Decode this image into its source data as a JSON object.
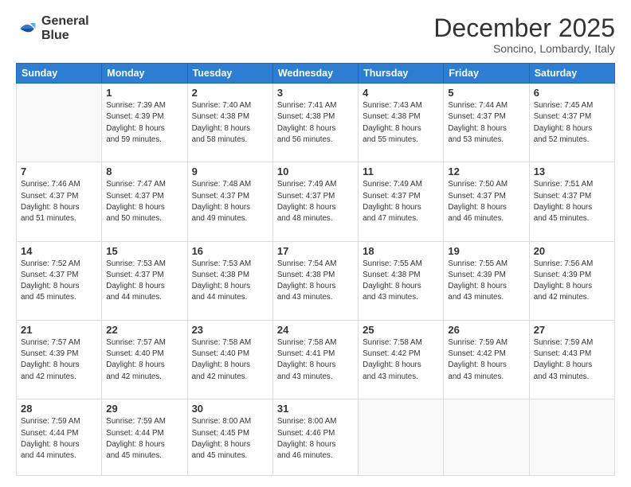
{
  "logo": {
    "line1": "General",
    "line2": "Blue"
  },
  "title": "December 2025",
  "location": "Soncino, Lombardy, Italy",
  "header_row": [
    "Sunday",
    "Monday",
    "Tuesday",
    "Wednesday",
    "Thursday",
    "Friday",
    "Saturday"
  ],
  "weeks": [
    [
      {
        "day": "",
        "info": ""
      },
      {
        "day": "1",
        "info": "Sunrise: 7:39 AM\nSunset: 4:39 PM\nDaylight: 8 hours\nand 59 minutes."
      },
      {
        "day": "2",
        "info": "Sunrise: 7:40 AM\nSunset: 4:38 PM\nDaylight: 8 hours\nand 58 minutes."
      },
      {
        "day": "3",
        "info": "Sunrise: 7:41 AM\nSunset: 4:38 PM\nDaylight: 8 hours\nand 56 minutes."
      },
      {
        "day": "4",
        "info": "Sunrise: 7:43 AM\nSunset: 4:38 PM\nDaylight: 8 hours\nand 55 minutes."
      },
      {
        "day": "5",
        "info": "Sunrise: 7:44 AM\nSunset: 4:37 PM\nDaylight: 8 hours\nand 53 minutes."
      },
      {
        "day": "6",
        "info": "Sunrise: 7:45 AM\nSunset: 4:37 PM\nDaylight: 8 hours\nand 52 minutes."
      }
    ],
    [
      {
        "day": "7",
        "info": "Sunrise: 7:46 AM\nSunset: 4:37 PM\nDaylight: 8 hours\nand 51 minutes."
      },
      {
        "day": "8",
        "info": "Sunrise: 7:47 AM\nSunset: 4:37 PM\nDaylight: 8 hours\nand 50 minutes."
      },
      {
        "day": "9",
        "info": "Sunrise: 7:48 AM\nSunset: 4:37 PM\nDaylight: 8 hours\nand 49 minutes."
      },
      {
        "day": "10",
        "info": "Sunrise: 7:49 AM\nSunset: 4:37 PM\nDaylight: 8 hours\nand 48 minutes."
      },
      {
        "day": "11",
        "info": "Sunrise: 7:49 AM\nSunset: 4:37 PM\nDaylight: 8 hours\nand 47 minutes."
      },
      {
        "day": "12",
        "info": "Sunrise: 7:50 AM\nSunset: 4:37 PM\nDaylight: 8 hours\nand 46 minutes."
      },
      {
        "day": "13",
        "info": "Sunrise: 7:51 AM\nSunset: 4:37 PM\nDaylight: 8 hours\nand 45 minutes."
      }
    ],
    [
      {
        "day": "14",
        "info": "Sunrise: 7:52 AM\nSunset: 4:37 PM\nDaylight: 8 hours\nand 45 minutes."
      },
      {
        "day": "15",
        "info": "Sunrise: 7:53 AM\nSunset: 4:37 PM\nDaylight: 8 hours\nand 44 minutes."
      },
      {
        "day": "16",
        "info": "Sunrise: 7:53 AM\nSunset: 4:38 PM\nDaylight: 8 hours\nand 44 minutes."
      },
      {
        "day": "17",
        "info": "Sunrise: 7:54 AM\nSunset: 4:38 PM\nDaylight: 8 hours\nand 43 minutes."
      },
      {
        "day": "18",
        "info": "Sunrise: 7:55 AM\nSunset: 4:38 PM\nDaylight: 8 hours\nand 43 minutes."
      },
      {
        "day": "19",
        "info": "Sunrise: 7:55 AM\nSunset: 4:39 PM\nDaylight: 8 hours\nand 43 minutes."
      },
      {
        "day": "20",
        "info": "Sunrise: 7:56 AM\nSunset: 4:39 PM\nDaylight: 8 hours\nand 42 minutes."
      }
    ],
    [
      {
        "day": "21",
        "info": "Sunrise: 7:57 AM\nSunset: 4:39 PM\nDaylight: 8 hours\nand 42 minutes."
      },
      {
        "day": "22",
        "info": "Sunrise: 7:57 AM\nSunset: 4:40 PM\nDaylight: 8 hours\nand 42 minutes."
      },
      {
        "day": "23",
        "info": "Sunrise: 7:58 AM\nSunset: 4:40 PM\nDaylight: 8 hours\nand 42 minutes."
      },
      {
        "day": "24",
        "info": "Sunrise: 7:58 AM\nSunset: 4:41 PM\nDaylight: 8 hours\nand 43 minutes."
      },
      {
        "day": "25",
        "info": "Sunrise: 7:58 AM\nSunset: 4:42 PM\nDaylight: 8 hours\nand 43 minutes."
      },
      {
        "day": "26",
        "info": "Sunrise: 7:59 AM\nSunset: 4:42 PM\nDaylight: 8 hours\nand 43 minutes."
      },
      {
        "day": "27",
        "info": "Sunrise: 7:59 AM\nSunset: 4:43 PM\nDaylight: 8 hours\nand 43 minutes."
      }
    ],
    [
      {
        "day": "28",
        "info": "Sunrise: 7:59 AM\nSunset: 4:44 PM\nDaylight: 8 hours\nand 44 minutes."
      },
      {
        "day": "29",
        "info": "Sunrise: 7:59 AM\nSunset: 4:44 PM\nDaylight: 8 hours\nand 45 minutes."
      },
      {
        "day": "30",
        "info": "Sunrise: 8:00 AM\nSunset: 4:45 PM\nDaylight: 8 hours\nand 45 minutes."
      },
      {
        "day": "31",
        "info": "Sunrise: 8:00 AM\nSunset: 4:46 PM\nDaylight: 8 hours\nand 46 minutes."
      },
      {
        "day": "",
        "info": ""
      },
      {
        "day": "",
        "info": ""
      },
      {
        "day": "",
        "info": ""
      }
    ]
  ]
}
